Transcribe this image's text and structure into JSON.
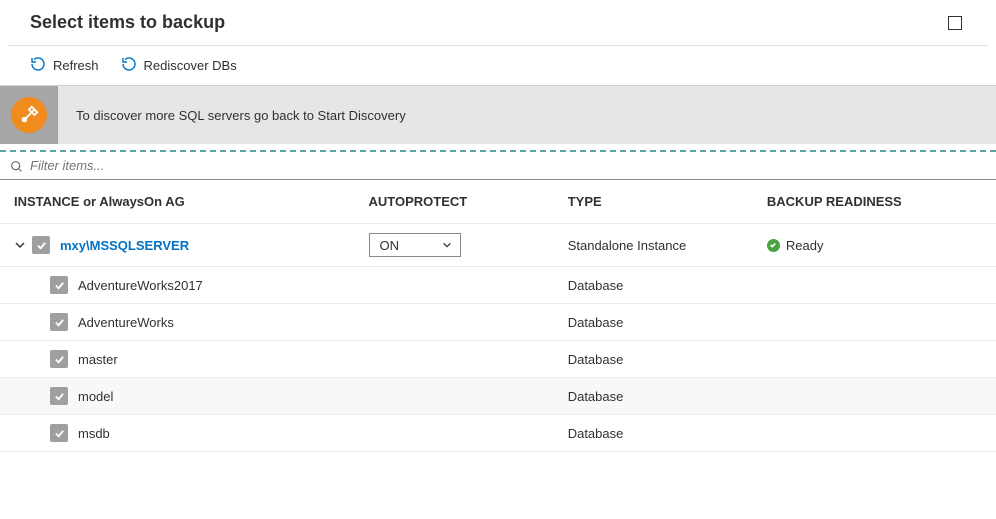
{
  "header": {
    "title": "Select items to backup"
  },
  "toolbar": {
    "refresh": "Refresh",
    "rediscover": "Rediscover DBs"
  },
  "info": {
    "text": "To discover more SQL servers go back to Start Discovery"
  },
  "filter": {
    "placeholder": "Filter items..."
  },
  "columns": {
    "instance": "INSTANCE or AlwaysOn AG",
    "autoprotect": "AUTOPROTECT",
    "type": "TYPE",
    "readiness": "BACKUP READINESS"
  },
  "instance": {
    "name": "mxy\\MSSQLSERVER",
    "autoprotect": "ON",
    "type": "Standalone Instance",
    "readiness": "Ready"
  },
  "databases": [
    {
      "name": "AdventureWorks2017",
      "type": "Database"
    },
    {
      "name": "AdventureWorks",
      "type": "Database"
    },
    {
      "name": "master",
      "type": "Database"
    },
    {
      "name": "model",
      "type": "Database"
    },
    {
      "name": "msdb",
      "type": "Database"
    }
  ]
}
